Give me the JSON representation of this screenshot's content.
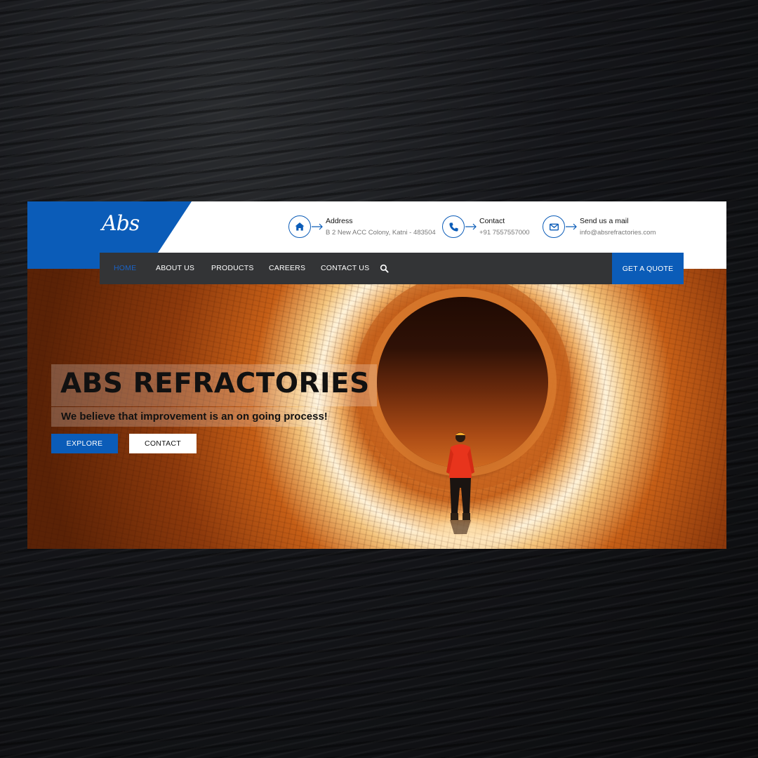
{
  "logo": {
    "text": "Abs"
  },
  "header": {
    "address": {
      "title": "Address",
      "value": "B 2 New ACC Colony, Katni - 483504",
      "icon": "home-icon"
    },
    "contact": {
      "title": "Contact",
      "value": "+91 7557557000",
      "icon": "phone-icon"
    },
    "mail": {
      "title": "Send us a mail",
      "value": "info@absrefractories.com",
      "icon": "envelope-icon"
    }
  },
  "nav": {
    "items": [
      "HOME",
      "ABOUT US",
      "PRODUCTS",
      "CAREERS",
      "CONTACT US"
    ],
    "active": "HOME",
    "search_icon": "search-icon",
    "quote_label": "GET A QUOTE"
  },
  "hero": {
    "title": "ABS REFRACTORIES",
    "subtitle": "We believe that improvement is an on going process!",
    "explore_label": "EXPLORE",
    "contact_label": "CONTACT"
  },
  "colors": {
    "brand": "#0b5cb8",
    "nav_bg": "#333436",
    "active_nav": "#1a62c4"
  }
}
